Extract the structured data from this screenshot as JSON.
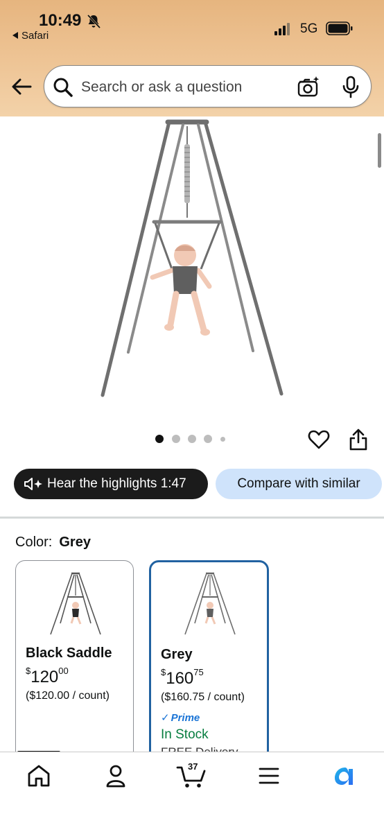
{
  "status_bar": {
    "time": "10:49",
    "back_app_label": "Safari",
    "network": "5G"
  },
  "search": {
    "placeholder": "Search or ask a question"
  },
  "carousel": {
    "total_images": 5,
    "active_index": 0
  },
  "actions": {
    "hear_label": "Hear the highlights 1:47",
    "compare_label": "Compare with similar"
  },
  "color_selector": {
    "label": "Color:",
    "selected": "Grey",
    "options": [
      {
        "name": "Black Saddle",
        "price_symbol": "$",
        "price_whole": "120",
        "price_fraction": "00",
        "unit_price": "($120.00 / count)"
      },
      {
        "name": "Grey",
        "price_symbol": "$",
        "price_whole": "160",
        "price_fraction": "75",
        "unit_price": "($160.75 / count)",
        "prime": "Prime",
        "stock": "In Stock",
        "delivery": "FREE Delivery"
      }
    ]
  },
  "bottom_nav": {
    "cart_count": "37"
  },
  "colors": {
    "header_top": "#e6b57f",
    "header_bottom": "#f3d2a9",
    "selected_border": "#2162a1",
    "prime_blue": "#1a74d6",
    "in_stock_green": "#067d3f",
    "compare_bg": "#cfe3fb"
  }
}
